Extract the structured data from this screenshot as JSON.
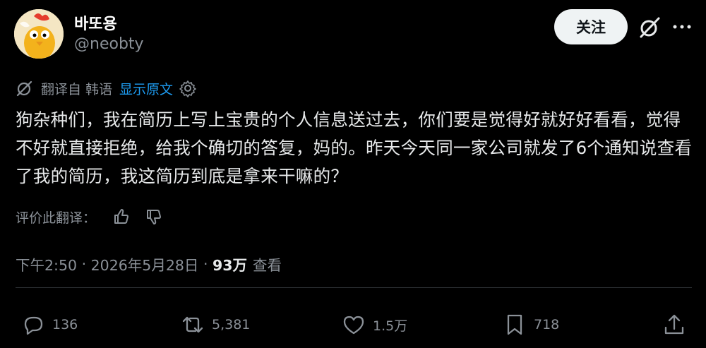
{
  "author": {
    "display_name": "바또용",
    "handle": "@neobty"
  },
  "follow_label": "关注",
  "translation": {
    "translated_from": "翻译自 韩语",
    "show_original": "显示原文"
  },
  "post": {
    "text": "狗杂种们，我在简历上写上宝贵的个人信息送过去，你们要是觉得好就好好看看，觉得不好就直接拒绝，给我个确切的答复，妈的。昨天今天同一家公司就发了6个通知说查看了我的简历，我这简历到底是拿来干嘛的？"
  },
  "rate_translation": "评价此翻译：",
  "meta": {
    "time": "下午2:50",
    "date": "2026年5月28日",
    "views_count": "93万",
    "views_label": "查看"
  },
  "actions": {
    "replies": "136",
    "reposts": "5,381",
    "likes": "1.5万",
    "bookmarks": "718"
  },
  "colors": {
    "background": "#000000",
    "text": "#e7e9ea",
    "secondary": "#8b9198",
    "link": "#1d9bf0",
    "button_bg": "#eff3f4"
  },
  "icons": [
    "grok-icon",
    "more-icon",
    "translate-icon",
    "settings-gear-icon",
    "thumbs-up-icon",
    "thumbs-down-icon",
    "reply-icon",
    "repost-icon",
    "like-icon",
    "bookmark-icon",
    "share-icon"
  ]
}
